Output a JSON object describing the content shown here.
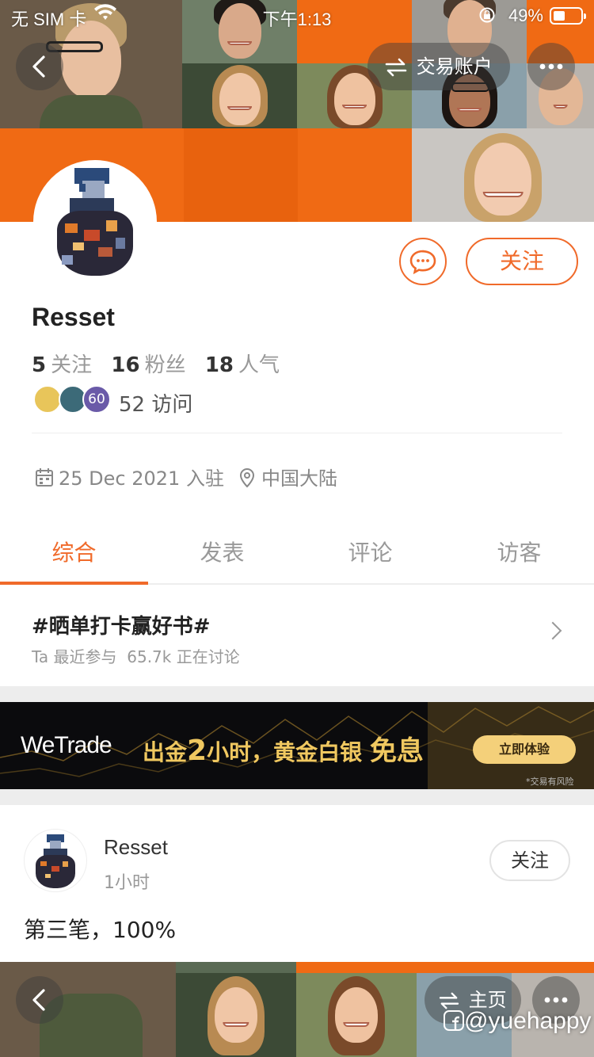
{
  "status_bar": {
    "carrier": "无 SIM 卡",
    "time": "下午1:13",
    "battery": "49%"
  },
  "header": {
    "switch_label": "交易账户",
    "back_icon": "back-chevron-icon",
    "more_icon": "more-dots-icon",
    "switch_icon": "swap-arrows-icon"
  },
  "profile": {
    "name": "Resset",
    "follow_label": "关注",
    "stats": [
      {
        "value": "5",
        "label": "关注"
      },
      {
        "value": "16",
        "label": "粉丝"
      },
      {
        "value": "18",
        "label": "人气"
      }
    ],
    "visitor_badge": "60",
    "visits": "52 访问",
    "join_date": "25 Dec 2021 入驻",
    "location": "中国大陆"
  },
  "tabs": [
    {
      "label": "综合",
      "active": true
    },
    {
      "label": "发表",
      "active": false
    },
    {
      "label": "评论",
      "active": false
    },
    {
      "label": "访客",
      "active": false
    }
  ],
  "topic": {
    "title": "#晒单打卡赢好书#",
    "participation": "Ta 最近参与",
    "discussing": "65.7k 正在讨论"
  },
  "ad": {
    "brand": "WeTrade",
    "headline_prefix": "出金",
    "headline_number": "2",
    "headline_middle": "小时，黄金白银",
    "headline_strong": "免息",
    "cta": "立即体验",
    "disclaimer": "*交易有风险"
  },
  "post": {
    "author": "Resset",
    "time": "1小时",
    "follow_label": "关注",
    "text": "第三笔，100%"
  },
  "bottom_bar": {
    "home_label": "主页",
    "watermark": "@yuehappy"
  },
  "colors": {
    "accent": "#f06a2a",
    "header_orange": "#f06a14"
  }
}
